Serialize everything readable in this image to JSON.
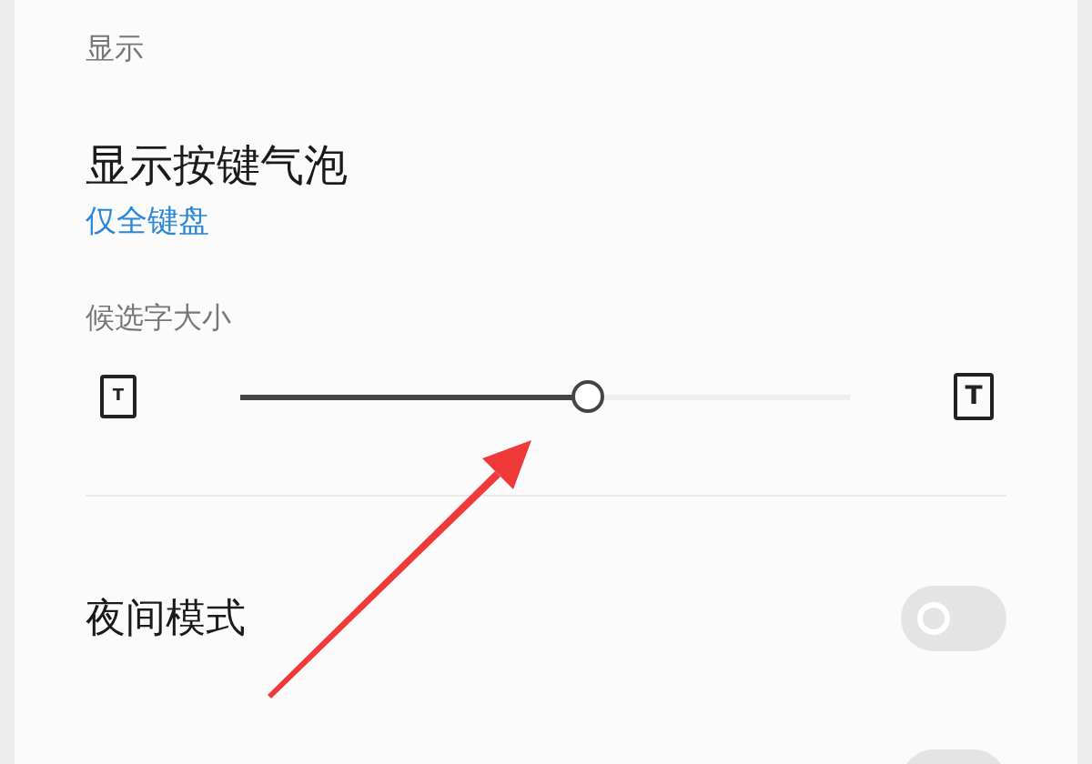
{
  "section_header": "显示",
  "key_bubble": {
    "title": "显示按键气泡",
    "value": "仅全键盘"
  },
  "candidate_size": {
    "label": "候选字大小",
    "small_icon": "T",
    "large_icon": "T",
    "level": 0.57
  },
  "toggles": [
    {
      "label": "夜间模式",
      "on": false
    },
    {
      "on": false
    }
  ]
}
